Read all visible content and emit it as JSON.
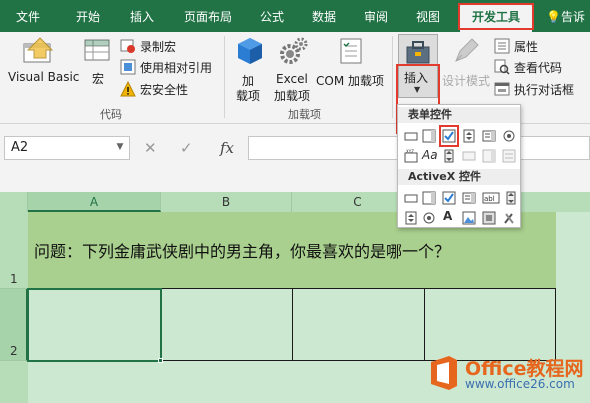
{
  "tabs": [
    {
      "label": "文件"
    },
    {
      "label": "开始"
    },
    {
      "label": "插入"
    },
    {
      "label": "页面布局"
    },
    {
      "label": "公式"
    },
    {
      "label": "数据"
    },
    {
      "label": "审阅"
    },
    {
      "label": "视图"
    },
    {
      "label": "开发工具",
      "active": true
    },
    {
      "label": "告诉"
    }
  ],
  "ribbon": {
    "code": {
      "visual_basic": "Visual Basic",
      "macros": "宏",
      "record_macro": "录制宏",
      "relative_ref": "使用相对引用",
      "macro_security": "宏安全性",
      "group_label": "代码"
    },
    "addins": {
      "addins_line1": "加",
      "addins_line2": "载项",
      "excel_addins_line1": "Excel",
      "excel_addins_line2": "加载项",
      "com_addins": "COM 加载项",
      "group_label": "加载项"
    },
    "controls": {
      "insert": "插入",
      "design_mode": "设计模式",
      "properties": "属性",
      "view_code": "查看代码",
      "run_dialog": "执行对话框"
    }
  },
  "formula_bar": {
    "name_box": "A2",
    "cancel": "✕",
    "enter": "✓",
    "fx": "fx"
  },
  "sheet": {
    "columns": [
      "A",
      "B",
      "C"
    ],
    "rows": [
      "1",
      "2"
    ],
    "question": "问题：下列金庸武侠剧中的男主角，你最喜欢的是哪一个？"
  },
  "insert_panel": {
    "form_controls_title": "表单控件",
    "activex_title": "ActiveX 控件"
  },
  "watermark": {
    "title": "Office教程网",
    "url": "www.office26.com"
  },
  "colors": {
    "brand": "#217346",
    "highlight": "#e23b2e",
    "sheet_bg": "#cde8d0",
    "question_bg": "#a9d08e"
  }
}
